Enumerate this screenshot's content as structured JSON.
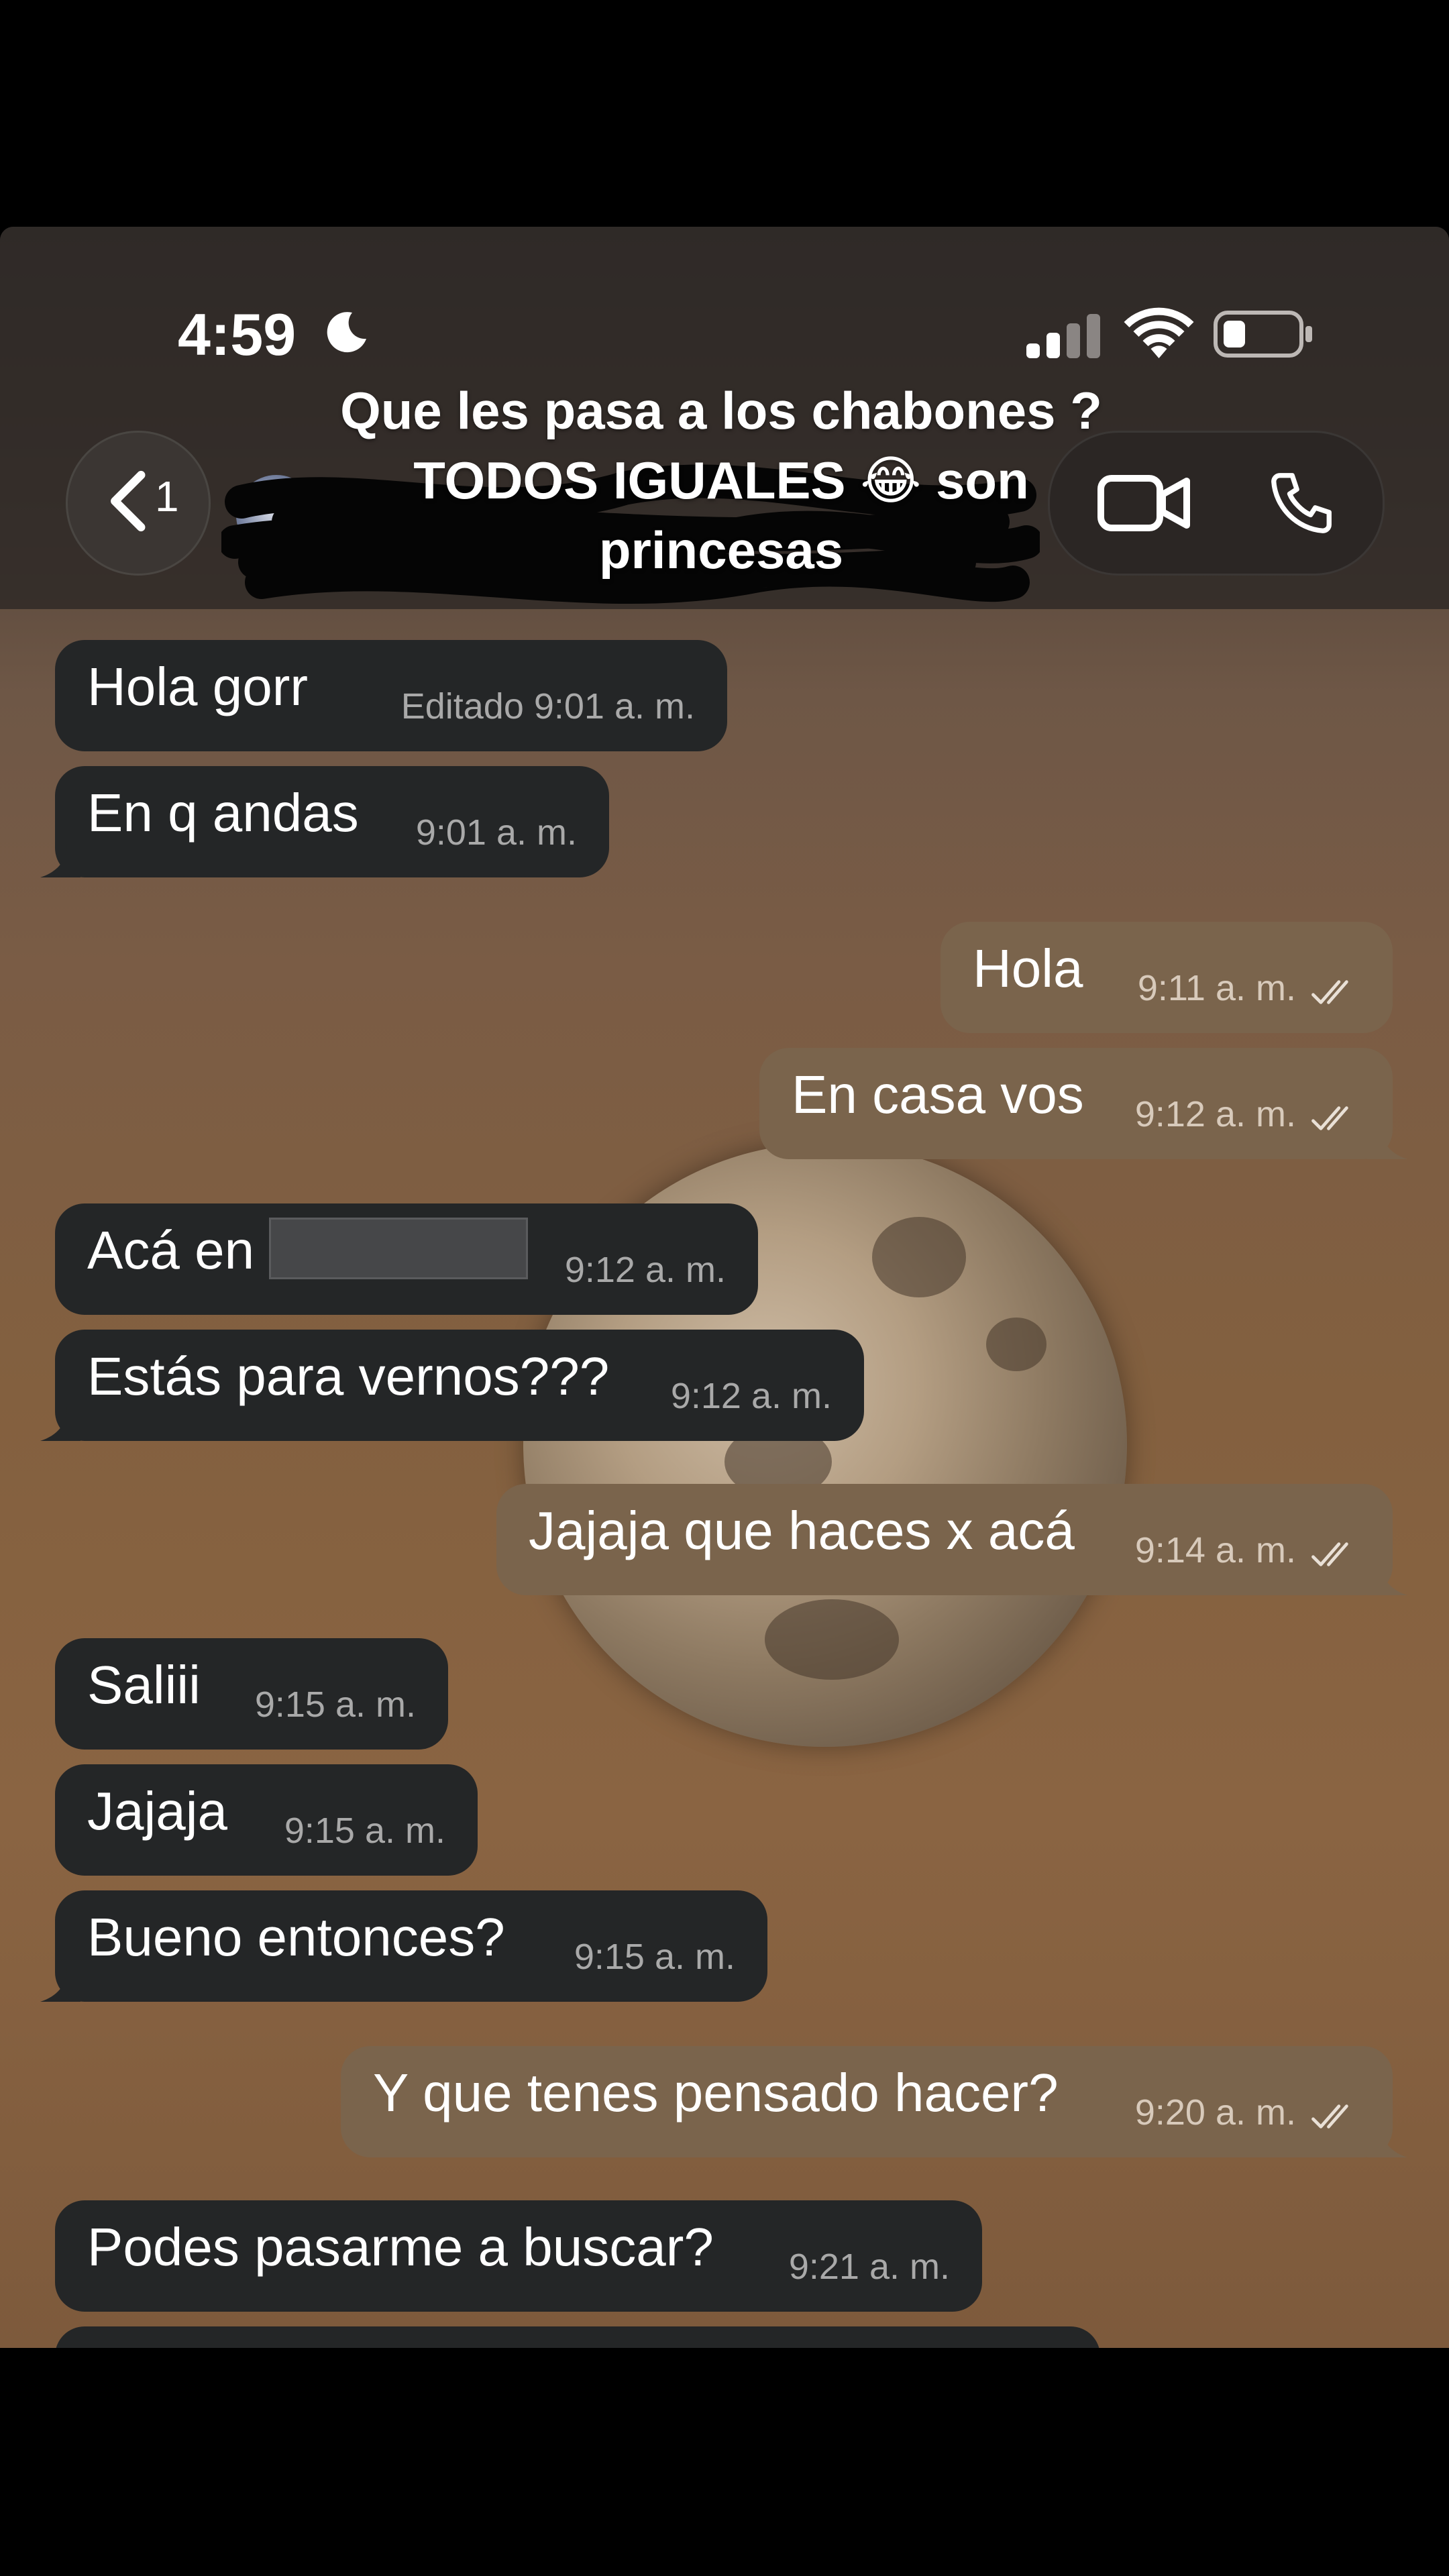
{
  "status_bar": {
    "time": "4:59",
    "icons": [
      "moon-icon",
      "signal-icon",
      "wifi-icon",
      "battery-icon"
    ]
  },
  "header": {
    "back_count": "1",
    "title": "Que les pasa a los chabones ? TODOS IGUALES 😂 son princesas",
    "icons": [
      "back-chevron-icon",
      "video-call-icon",
      "phone-call-icon"
    ]
  },
  "messages": [
    {
      "dir": "in",
      "text": "Hola gorr",
      "time": "Editado 9:01 a. m."
    },
    {
      "dir": "in",
      "text": "En q andas",
      "time": "9:01 a. m."
    },
    {
      "dir": "out",
      "text": "Hola",
      "time": "9:11 a. m."
    },
    {
      "dir": "out",
      "text": "En casa vos",
      "time": "9:12 a. m."
    },
    {
      "dir": "in",
      "text": "Acá en",
      "time": "9:12 a. m."
    },
    {
      "dir": "in",
      "text": "Estás para vernos???",
      "time": "9:12 a. m."
    },
    {
      "dir": "out",
      "text": "Jajaja que haces x acá",
      "time": "9:14 a. m."
    },
    {
      "dir": "in",
      "text": "Saliii",
      "time": "9:15 a. m."
    },
    {
      "dir": "in",
      "text": "Jajaja",
      "time": "9:15 a. m."
    },
    {
      "dir": "in",
      "text": "Bueno entonces?",
      "time": "9:15 a. m."
    },
    {
      "dir": "out",
      "text": "Y que tenes pensado hacer?",
      "time": "9:20 a. m."
    },
    {
      "dir": "in",
      "text": "Podes pasarme a buscar?",
      "time": "9:21 a. m."
    }
  ],
  "colors": {
    "incoming_bubble": "#242627",
    "outgoing_bubble": "#7a644c",
    "timestamp": "#a9a9a9"
  }
}
